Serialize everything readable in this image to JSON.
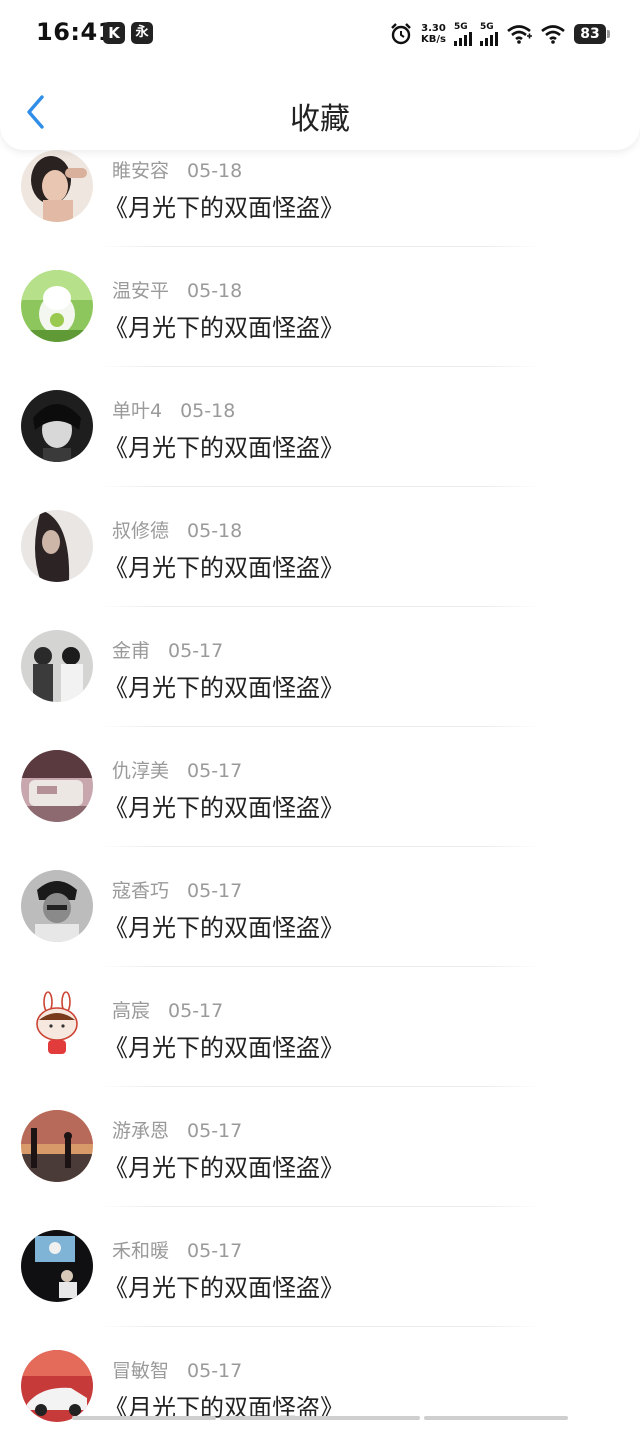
{
  "status_bar": {
    "time": "16:41",
    "app_icon_1": "K",
    "app_icon_2": "永",
    "net_speed_value": "3.30",
    "net_speed_unit": "KB/s",
    "sim1_label": "5G",
    "sim2_label": "5G",
    "battery": "83",
    "icons": [
      "alarm-icon",
      "signal-icon",
      "signal-icon",
      "wifi-icon",
      "wifi-icon",
      "battery-icon"
    ]
  },
  "nav": {
    "title": "收藏",
    "back_icon": "chevron-left-icon",
    "accent": "#2f8ee8"
  },
  "items": [
    {
      "name": "睢安容",
      "date": "05-18",
      "title": "《月光下的双面怪盗》"
    },
    {
      "name": "温安平",
      "date": "05-18",
      "title": "《月光下的双面怪盗》"
    },
    {
      "name": "单叶4",
      "date": "05-18",
      "title": "《月光下的双面怪盗》"
    },
    {
      "name": "叔修德",
      "date": "05-18",
      "title": "《月光下的双面怪盗》"
    },
    {
      "name": "金甫",
      "date": "05-17",
      "title": "《月光下的双面怪盗》"
    },
    {
      "name": "仇淳美",
      "date": "05-17",
      "title": "《月光下的双面怪盗》"
    },
    {
      "name": "寇香巧",
      "date": "05-17",
      "title": "《月光下的双面怪盗》"
    },
    {
      "name": "高宸",
      "date": "05-17",
      "title": "《月光下的双面怪盗》"
    },
    {
      "name": "游承恩",
      "date": "05-17",
      "title": "《月光下的双面怪盗》"
    },
    {
      "name": "禾和暖",
      "date": "05-17",
      "title": "《月光下的双面怪盗》"
    },
    {
      "name": "冒敏智",
      "date": "05-17",
      "title": "《月光下的双面怪盗》"
    }
  ]
}
